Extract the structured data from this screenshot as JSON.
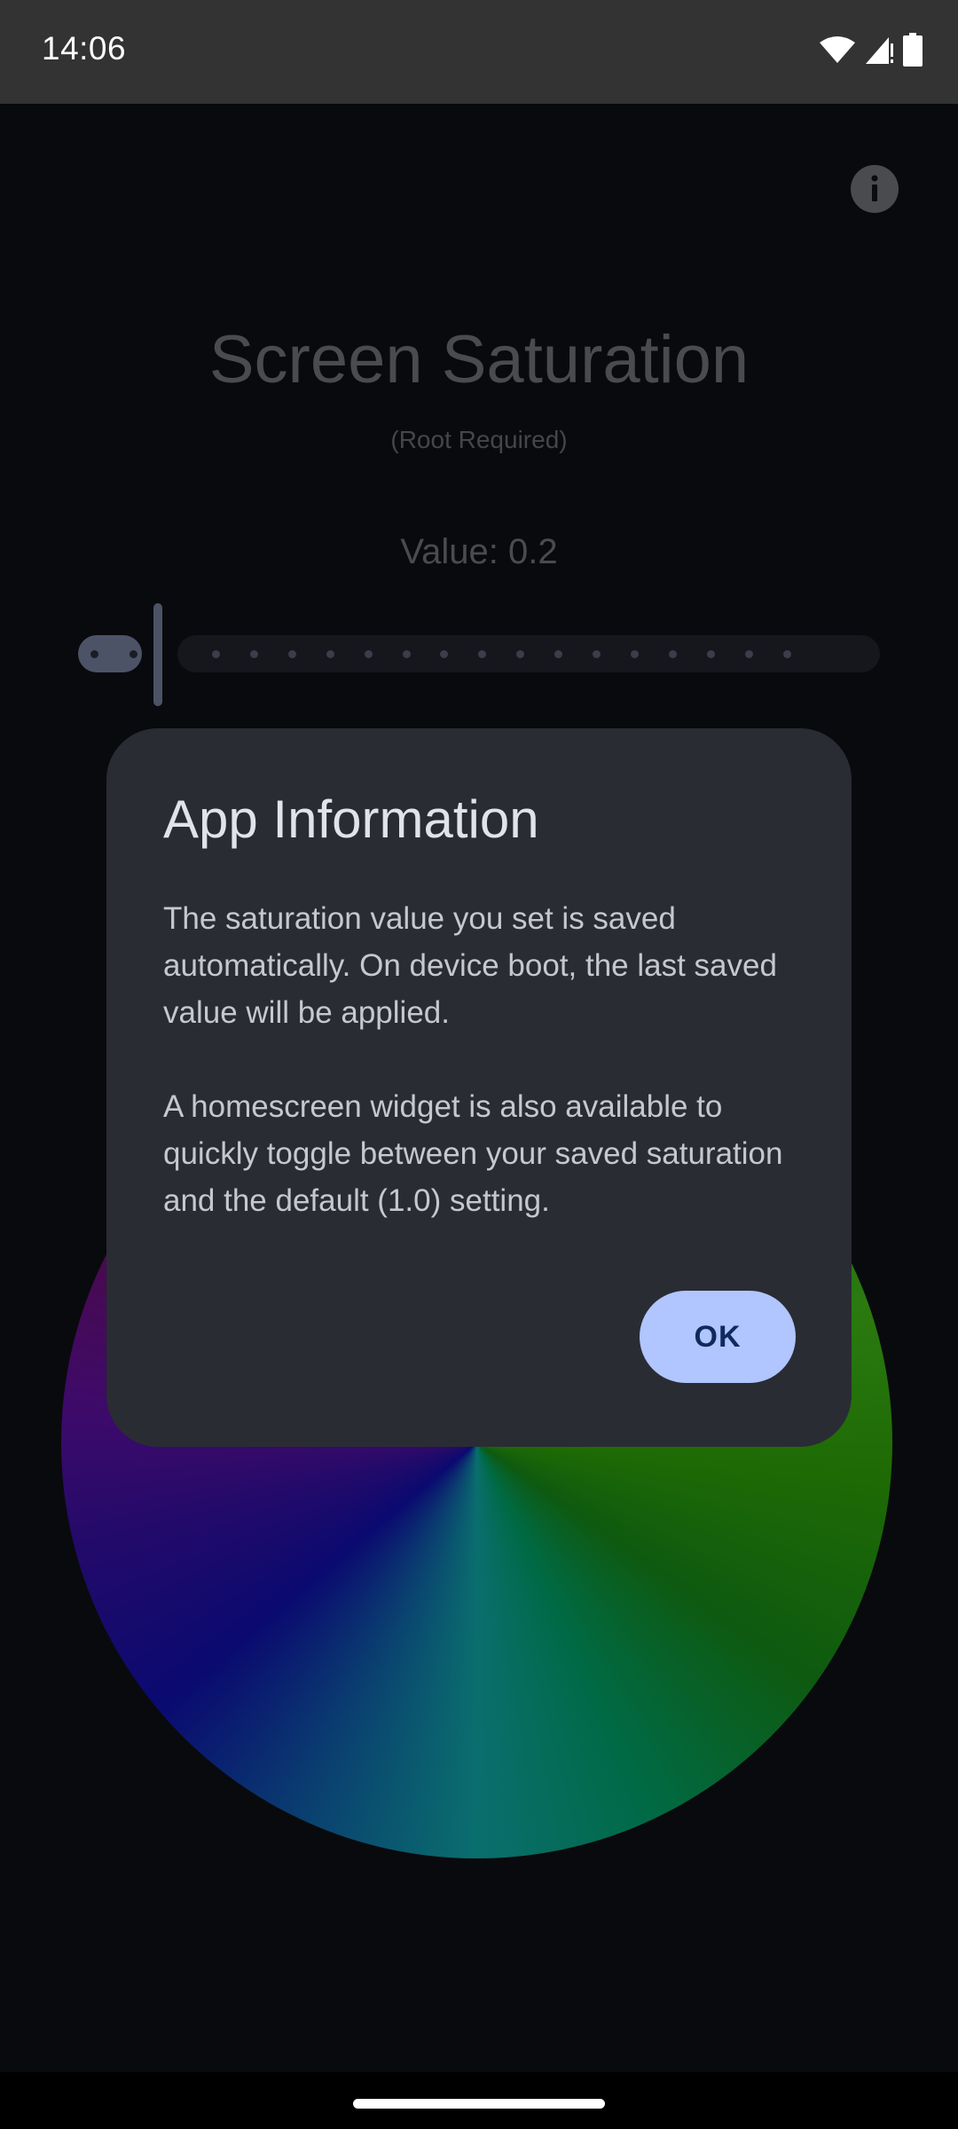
{
  "status_bar": {
    "time": "14:06",
    "icons": [
      "wifi-icon",
      "cellular-signal-icon",
      "battery-icon"
    ]
  },
  "app": {
    "title": "Screen Saturation",
    "subtitle": "(Root Required)",
    "value_label": "Value: 0.2",
    "info_icon": "info-icon",
    "slider": {
      "value": 0.2,
      "min": 0,
      "max": 1,
      "step": 0.05
    }
  },
  "dialog": {
    "title": "App Information",
    "paragraph_1": "The saturation value you set is saved automatically. On device boot, the last saved value will be applied.",
    "paragraph_2": "A homescreen widget is also available to quickly toggle between your saved saturation and the default (1.0) setting.",
    "ok_label": "OK"
  },
  "colors": {
    "background": "#090a0d",
    "dialog_surface": "#2a2c34",
    "ok_button": "#b1c5ff",
    "slider_active": "#4c5367"
  }
}
